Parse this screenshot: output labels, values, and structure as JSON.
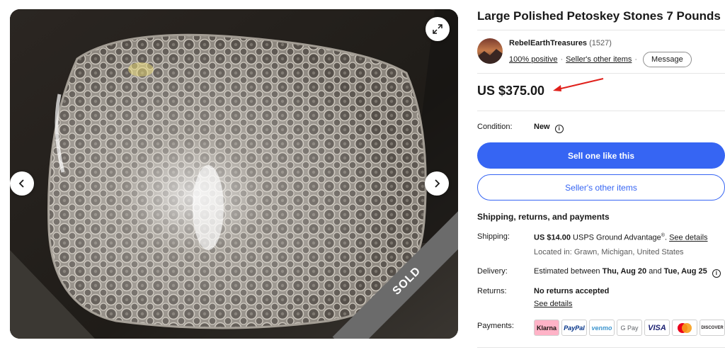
{
  "listing": {
    "title": "Large Polished Petoskey Stones 7 Pounds",
    "sold_badge": "SOLD"
  },
  "seller": {
    "name": "RebelEarthTreasures",
    "feedback_count": "(1527)",
    "positive": "100% positive",
    "other_items": "Seller's other items",
    "message_label": "Message"
  },
  "price": {
    "value": "US $375.00"
  },
  "condition": {
    "label": "Condition:",
    "value": "New"
  },
  "actions": {
    "primary_label": "Sell one like this",
    "secondary_label": "Seller's other items"
  },
  "shipping_section": {
    "title": "Shipping, returns, and payments",
    "shipping_label": "Shipping:",
    "shipping_price": "US $14.00",
    "shipping_service": "USPS Ground Advantage",
    "shipping_service_mark": "®",
    "shipping_link": "See details",
    "location": "Located in: Grawn, Michigan, United States",
    "delivery_label": "Delivery:",
    "delivery_prefix": "Estimated between ",
    "delivery_start": "Thu, Aug 20",
    "delivery_and": " and ",
    "delivery_end": "Tue, Aug 25",
    "returns_label": "Returns:",
    "returns_value": "No returns accepted",
    "returns_link": "See details",
    "payments_label": "Payments:",
    "payment_methods": [
      "Klarna",
      "PayPal",
      "venmo",
      "G Pay",
      "VISA",
      "",
      "DISCOVER"
    ]
  },
  "colors": {
    "accent": "#3665f3",
    "annotation_arrow": "#e0201b",
    "sold_ribbon": "#6b6b6b"
  }
}
